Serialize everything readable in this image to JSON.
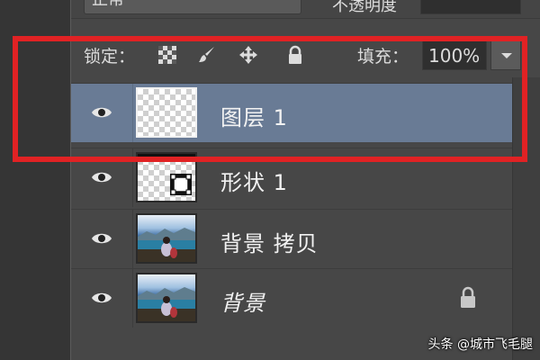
{
  "top_bar": {
    "mode_value": "正常",
    "opacity_label": "不透明度"
  },
  "lock_row": {
    "label": "锁定：",
    "icons": [
      "lock-transparent-icon",
      "lock-paint-icon",
      "lock-move-icon",
      "lock-all-icon"
    ],
    "fill_label": "填充：",
    "fill_value": "100%"
  },
  "layers": [
    {
      "name": "图层 1",
      "selected": true,
      "thumbnail": "transparent"
    },
    {
      "name": "形状 1",
      "selected": false,
      "thumbnail": "transparent-with-shape"
    },
    {
      "name": "背景 拷贝",
      "selected": false,
      "thumbnail": "photo"
    },
    {
      "name": "背景",
      "selected": false,
      "thumbnail": "photo",
      "locked": true
    }
  ],
  "colors": {
    "panel": "#474747",
    "selected_row": "#697b95",
    "highlight_border": "#e12224"
  },
  "watermark": "头条 @城市飞毛腿"
}
